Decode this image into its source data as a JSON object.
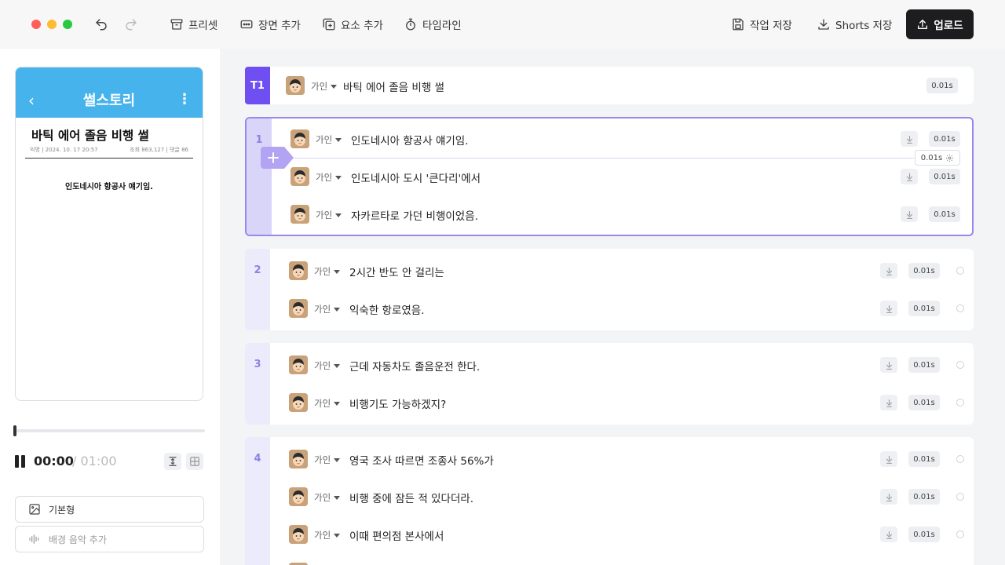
{
  "toolbar": {
    "preset": "프리셋",
    "add_scene": "장면 추가",
    "add_element": "요소 추가",
    "timeline": "타임라인",
    "save_work": "작업 저장",
    "save_shorts": "Shorts 저장",
    "upload": "업로드"
  },
  "preview": {
    "app_title": "썰스토리",
    "post_title": "바틱 에어 졸음 비행 썰",
    "meta_left": "익명 | 2024. 10. 17 20:57",
    "meta_right": "조회 863,127 | 댓글 86",
    "body_text": "인도네시아 항공사 얘기임.",
    "time_current": "00:00",
    "time_total": "/ 01:00",
    "progress": 0
  },
  "side_buttons": {
    "basic": "기본형",
    "bgm": "배경 음악 추가"
  },
  "title_row": {
    "label": "T1",
    "speaker": "가인",
    "text": "바틱 에어 졸음 비행 썰",
    "duration": "0.01s"
  },
  "gap_chip": "0.01s",
  "scenes": [
    {
      "number": "1",
      "lines": [
        {
          "speaker": "가인",
          "text": "인도네시아 항공사 얘기임.",
          "duration": "0.01s"
        },
        {
          "speaker": "가인",
          "text": "인도네시아 도시 '큰다리'에서",
          "duration": "0.01s"
        },
        {
          "speaker": "가인",
          "text": "자카르타로 가던 비행이었음.",
          "duration": "0.01s"
        }
      ]
    },
    {
      "number": "2",
      "lines": [
        {
          "speaker": "가인",
          "text": "2시간 반도 안 걸리는",
          "duration": "0.01s"
        },
        {
          "speaker": "가인",
          "text": "익숙한 항로였음.",
          "duration": "0.01s"
        }
      ]
    },
    {
      "number": "3",
      "lines": [
        {
          "speaker": "가인",
          "text": "근데 자동차도 졸음운전 한다.",
          "duration": "0.01s"
        },
        {
          "speaker": "가인",
          "text": "비행기도 가능하겠지?",
          "duration": "0.01s"
        }
      ]
    },
    {
      "number": "4",
      "lines": [
        {
          "speaker": "가인",
          "text": "영국 조사 따르면 조종사 56%가",
          "duration": "0.01s"
        },
        {
          "speaker": "가인",
          "text": "비행 중에 잠든 적 있다더라.",
          "duration": "0.01s"
        },
        {
          "speaker": "가인",
          "text": "이때 편의점 본사에서",
          "duration": "0.01s"
        }
      ]
    }
  ]
}
